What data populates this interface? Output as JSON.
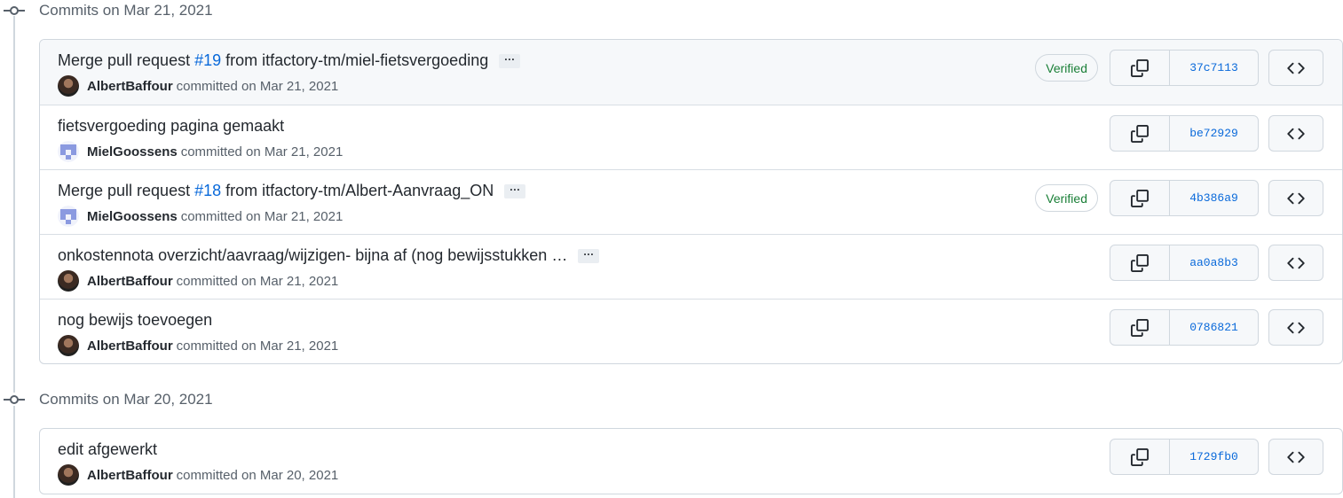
{
  "groups": [
    {
      "title": "Commits on Mar 21, 2021",
      "commits": [
        {
          "msg_pre": "Merge pull request ",
          "pr": "#19",
          "msg_post": " from itfactory-tm/miel-fietsvergoeding",
          "ellipsis": "···",
          "author": "AlbertBaffour",
          "meta": "committed on Mar 21, 2021",
          "verified": "Verified",
          "sha": "37c7113",
          "avatar": "photo"
        },
        {
          "msg_pre": "fietsvergoeding pagina gemaakt",
          "pr": "",
          "msg_post": "",
          "ellipsis": "",
          "author": "MielGoossens",
          "meta": "committed on Mar 21, 2021",
          "verified": "",
          "sha": "be72929",
          "avatar": "identicon"
        },
        {
          "msg_pre": "Merge pull request ",
          "pr": "#18",
          "msg_post": " from itfactory-tm/Albert-Aanvraag_ON",
          "ellipsis": "···",
          "author": "MielGoossens",
          "meta": "committed on Mar 21, 2021",
          "verified": "Verified",
          "sha": "4b386a9",
          "avatar": "identicon"
        },
        {
          "msg_pre": "onkostennota overzicht/aavraag/wijzigen- bijna af (nog bewijsstukken …",
          "pr": "",
          "msg_post": "",
          "ellipsis": "···",
          "author": "AlbertBaffour",
          "meta": "committed on Mar 21, 2021",
          "verified": "",
          "sha": "aa0a8b3",
          "avatar": "photo"
        },
        {
          "msg_pre": "nog bewijs toevoegen",
          "pr": "",
          "msg_post": "",
          "ellipsis": "",
          "author": "AlbertBaffour",
          "meta": "committed on Mar 21, 2021",
          "verified": "",
          "sha": "0786821",
          "avatar": "photo"
        }
      ]
    },
    {
      "title": "Commits on Mar 20, 2021",
      "commits": [
        {
          "msg_pre": "edit afgewerkt",
          "pr": "",
          "msg_post": "",
          "ellipsis": "",
          "author": "AlbertBaffour",
          "meta": "committed on Mar 20, 2021",
          "verified": "",
          "sha": "1729fb0",
          "avatar": "photo"
        }
      ]
    }
  ],
  "icons": {
    "commit": "git-commit-icon",
    "copy": "copy-icon",
    "browse": "code-icon"
  },
  "colors": {
    "link": "#0969da",
    "verified": "#1a7f37",
    "muted": "#57606a",
    "identicon": "#8b9ae0"
  }
}
